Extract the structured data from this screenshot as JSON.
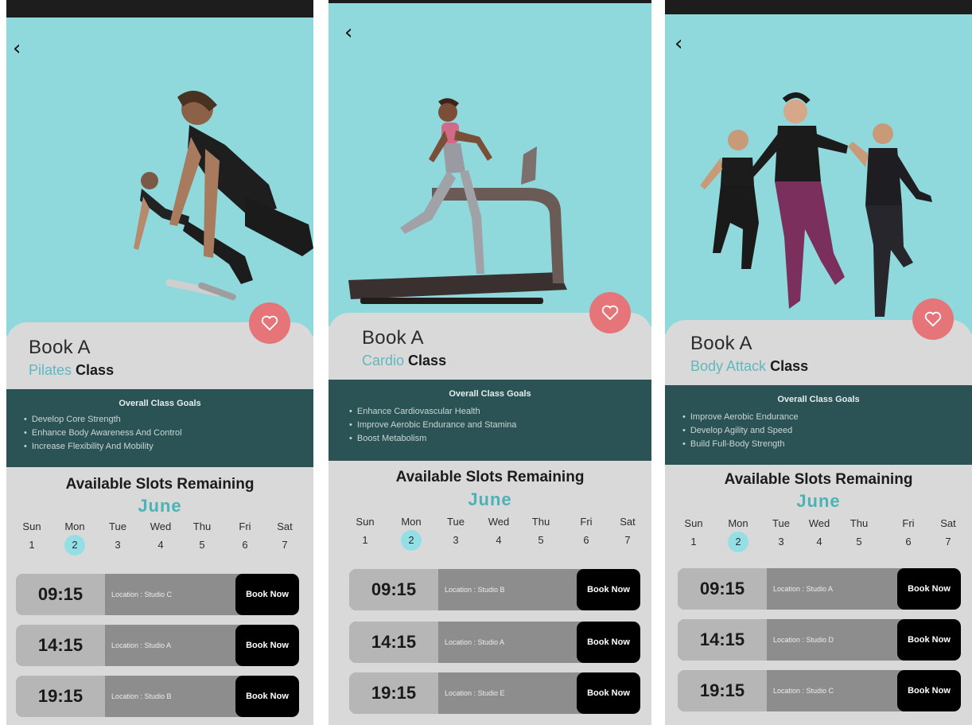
{
  "colors": {
    "accent_teal": "#5fb8be",
    "hero_bg": "#8fd8dc",
    "goals_bg": "#2b5254",
    "heart": "#e57578",
    "book_button": "#000000"
  },
  "icons": {
    "back": "chevron-left-icon",
    "favorite": "heart-icon"
  },
  "screens": [
    {
      "title_line1": "Book A",
      "class_name": "Pilates",
      "class_suffix": "Class",
      "goals_heading": "Overall Class Goals",
      "goals": [
        "Develop Core Strength",
        "Enhance Body Awareness And Control",
        "Increase Flexibility And Mobility"
      ],
      "slots_title": "Available Slots Remaining",
      "month": "June",
      "days": [
        {
          "name": "Sun",
          "date": "1"
        },
        {
          "name": "Mon",
          "date": "2"
        },
        {
          "name": "Tue",
          "date": "3"
        },
        {
          "name": "Wed",
          "date": "4"
        },
        {
          "name": "Thu",
          "date": "5"
        },
        {
          "name": "Fri",
          "date": "6"
        },
        {
          "name": "Sat",
          "date": "7"
        }
      ],
      "selected_date": "2",
      "slots": [
        {
          "time": "09:15",
          "location": "Location : Studio C",
          "button": "Book Now"
        },
        {
          "time": "14:15",
          "location": "Location : Studio A",
          "button": "Book Now"
        },
        {
          "time": "19:15",
          "location": "Location : Studio B",
          "button": "Book Now"
        }
      ]
    },
    {
      "title_line1": "Book A",
      "class_name": "Cardio",
      "class_suffix": "Class",
      "goals_heading": "Overall Class Goals",
      "goals": [
        "Enhance Cardiovascular Health",
        "Improve Aerobic Endurance and Stamina",
        "Boost Metabolism"
      ],
      "slots_title": "Available Slots Remaining",
      "month": "June",
      "days": [
        {
          "name": "Sun",
          "date": "1"
        },
        {
          "name": "Mon",
          "date": "2"
        },
        {
          "name": "Tue",
          "date": "3"
        },
        {
          "name": "Wed",
          "date": "4"
        },
        {
          "name": "Thu",
          "date": "5"
        },
        {
          "name": "Fri",
          "date": "6"
        },
        {
          "name": "Sat",
          "date": "7"
        }
      ],
      "selected_date": "2",
      "slots": [
        {
          "time": "09:15",
          "location": "Location : Studio B",
          "button": "Book Now"
        },
        {
          "time": "14:15",
          "location": "Location : Studio A",
          "button": "Book Now"
        },
        {
          "time": "19:15",
          "location": "Location : Studio E",
          "button": "Book Now"
        }
      ]
    },
    {
      "title_line1": "Book A",
      "class_name": "Body Attack",
      "class_suffix": "Class",
      "goals_heading": "Overall Class Goals",
      "goals": [
        "Improve Aerobic Endurance",
        "Develop Agility and Speed",
        "Build Full-Body Strength"
      ],
      "slots_title": "Available Slots Remaining",
      "month": "June",
      "days": [
        {
          "name": "Sun",
          "date": "1"
        },
        {
          "name": "Mon",
          "date": "2"
        },
        {
          "name": "Tue",
          "date": "3"
        },
        {
          "name": "Wed",
          "date": "4"
        },
        {
          "name": "Thu",
          "date": "5"
        },
        {
          "name": "Fri",
          "date": "6"
        },
        {
          "name": "Sat",
          "date": "7"
        }
      ],
      "selected_date": "2",
      "slots": [
        {
          "time": "09:15",
          "location": "Location : Studio A",
          "button": "Book Now"
        },
        {
          "time": "14:15",
          "location": "Location : Studio D",
          "button": "Book Now"
        },
        {
          "time": "19:15",
          "location": "Location : Studio C",
          "button": "Book Now"
        }
      ]
    }
  ]
}
